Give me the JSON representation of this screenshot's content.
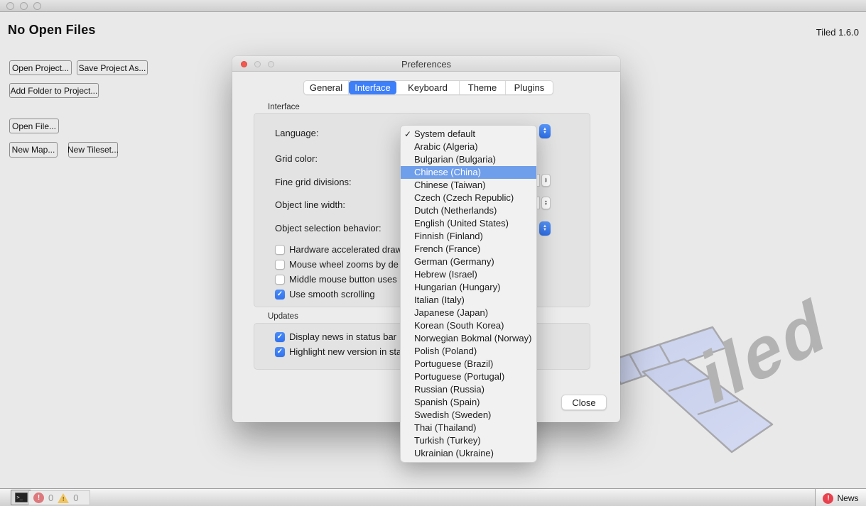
{
  "app": {
    "heading": "No Open Files",
    "version": "Tiled 1.6.0"
  },
  "project_buttons": {
    "open_project": "Open Project...",
    "save_project_as": "Save Project As...",
    "add_folder": "Add Folder to Project...",
    "open_file": "Open File...",
    "new_map": "New Map...",
    "new_tileset": "New Tileset..."
  },
  "dialog": {
    "title": "Preferences",
    "tabs": [
      "General",
      "Interface",
      "Keyboard",
      "Theme",
      "Plugins"
    ],
    "active_tab": "Interface",
    "interface_group": {
      "label": "Interface",
      "fields": [
        {
          "label": "Language:"
        },
        {
          "label": "Grid color:"
        },
        {
          "label": "Fine grid divisions:"
        },
        {
          "label": "Object line width:"
        },
        {
          "label": "Object selection behavior:"
        }
      ],
      "checkboxes": [
        {
          "label": "Hardware accelerated draw",
          "checked": false
        },
        {
          "label": "Mouse wheel zooms by de",
          "checked": false
        },
        {
          "label": "Middle mouse button uses",
          "checked": false
        },
        {
          "label": "Use smooth scrolling",
          "checked": true
        }
      ]
    },
    "updates_group": {
      "label": "Updates",
      "checkboxes": [
        {
          "label": "Display news in status bar",
          "checked": true
        },
        {
          "label": "Highlight new version in sta",
          "checked": true
        }
      ]
    },
    "close_button": "Close"
  },
  "language_dropdown": {
    "checked_value": "System default",
    "highlighted_value": "Chinese (China)",
    "check_glyph": "✓",
    "items": [
      "System default",
      "Arabic (Algeria)",
      "Bulgarian (Bulgaria)",
      "Chinese (China)",
      "Chinese (Taiwan)",
      "Czech (Czech Republic)",
      "Dutch (Netherlands)",
      "English (United States)",
      "Finnish (Finland)",
      "French (France)",
      "German (Germany)",
      "Hebrew (Israel)",
      "Hungarian (Hungary)",
      "Italian (Italy)",
      "Japanese (Japan)",
      "Korean (South Korea)",
      "Norwegian Bokmal (Norway)",
      "Polish (Poland)",
      "Portuguese (Brazil)",
      "Portuguese (Portugal)",
      "Russian (Russia)",
      "Spanish (Spain)",
      "Swedish (Sweden)",
      "Thai (Thailand)",
      "Turkish (Turkey)",
      "Ukrainian (Ukraine)"
    ]
  },
  "status_bar": {
    "error_count": "0",
    "warning_count": "0",
    "news_label": "News"
  },
  "watermark": {
    "text": "iled"
  },
  "colors": {
    "accent_blue": "#3d7ff8",
    "list_highlight_blue": "#6f9eea",
    "checkbox_blue": "#3c82f7",
    "dialog_bg": "#ececec",
    "group_bg": "#e3e3e3",
    "window_bg": "#e9e9e9",
    "watermark_tile": "#ccd3ee",
    "watermark_text": "#b3b3b4",
    "error_red": "#dd787c",
    "news_red": "#e8414d",
    "warning_yellow": "#f0c55f"
  }
}
